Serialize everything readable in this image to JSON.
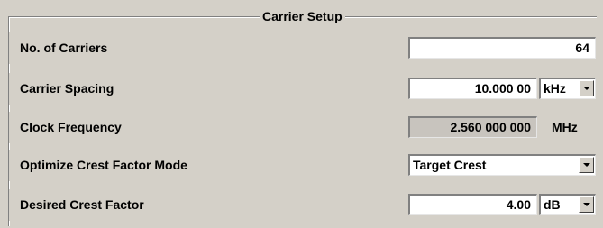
{
  "group": {
    "title": "Carrier Setup"
  },
  "rows": {
    "num_carriers": {
      "label": "No. of Carriers",
      "value": "64"
    },
    "carrier_spacing": {
      "label": "Carrier Spacing",
      "value": "10.000 00",
      "unit": "kHz"
    },
    "clock_frequency": {
      "label": "Clock Frequency",
      "value": "2.560 000 000",
      "unit": "MHz"
    },
    "optimize_mode": {
      "label": "Optimize Crest Factor Mode",
      "value": "Target Crest"
    },
    "desired_crest": {
      "label": "Desired Crest Factor",
      "value": "4.00",
      "unit": "dB"
    }
  },
  "icons": {
    "dropdown": "chevron-down-icon"
  },
  "colors": {
    "background": "#d4d0c8",
    "field": "#ffffff",
    "readonly_field": "#c8c4be"
  }
}
